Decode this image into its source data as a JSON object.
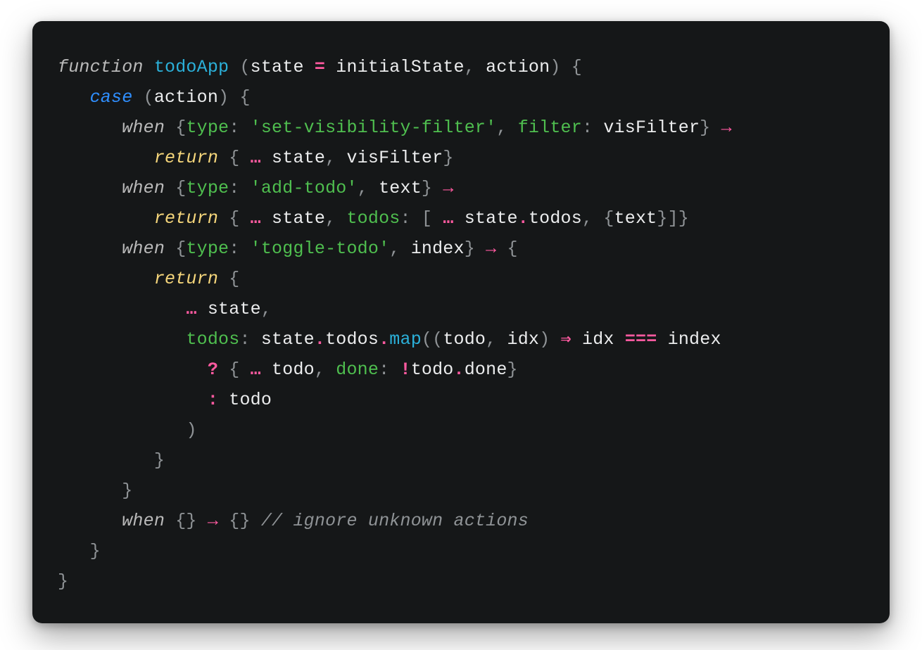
{
  "code": {
    "tokens": [
      [
        [
          "kw",
          "function"
        ],
        [
          "id",
          " "
        ],
        [
          "fn",
          "todoApp"
        ],
        [
          "id",
          " "
        ],
        [
          "punc",
          "("
        ],
        [
          "id",
          "state "
        ],
        [
          "op",
          "="
        ],
        [
          "id",
          " initialState"
        ],
        [
          "punc",
          ","
        ],
        [
          "id",
          " action"
        ],
        [
          "punc",
          ")"
        ],
        [
          "id",
          " "
        ],
        [
          "punc",
          "{"
        ]
      ],
      [
        [
          "id",
          "   "
        ],
        [
          "case",
          "case"
        ],
        [
          "id",
          " "
        ],
        [
          "punc",
          "("
        ],
        [
          "id",
          "action"
        ],
        [
          "punc",
          ")"
        ],
        [
          "id",
          " "
        ],
        [
          "punc",
          "{"
        ]
      ],
      [
        [
          "id",
          "      "
        ],
        [
          "kw",
          "when"
        ],
        [
          "id",
          " "
        ],
        [
          "punc",
          "{"
        ],
        [
          "prop",
          "type"
        ],
        [
          "punc",
          ":"
        ],
        [
          "id",
          " "
        ],
        [
          "str",
          "'set-visibility-filter'"
        ],
        [
          "punc",
          ","
        ],
        [
          "id",
          " "
        ],
        [
          "prop",
          "filter"
        ],
        [
          "punc",
          ":"
        ],
        [
          "id",
          " visFilter"
        ],
        [
          "punc",
          "}"
        ],
        [
          "id",
          " "
        ],
        [
          "op",
          "→"
        ]
      ],
      [
        [
          "id",
          "         "
        ],
        [
          "ret",
          "return"
        ],
        [
          "id",
          " "
        ],
        [
          "punc",
          "{"
        ],
        [
          "id",
          " "
        ],
        [
          "op",
          "…"
        ],
        [
          "id",
          " state"
        ],
        [
          "punc",
          ","
        ],
        [
          "id",
          " visFilter"
        ],
        [
          "punc",
          "}"
        ]
      ],
      [
        [
          "id",
          "      "
        ],
        [
          "kw",
          "when"
        ],
        [
          "id",
          " "
        ],
        [
          "punc",
          "{"
        ],
        [
          "prop",
          "type"
        ],
        [
          "punc",
          ":"
        ],
        [
          "id",
          " "
        ],
        [
          "str",
          "'add-todo'"
        ],
        [
          "punc",
          ","
        ],
        [
          "id",
          " text"
        ],
        [
          "punc",
          "}"
        ],
        [
          "id",
          " "
        ],
        [
          "op",
          "→"
        ]
      ],
      [
        [
          "id",
          "         "
        ],
        [
          "ret",
          "return"
        ],
        [
          "id",
          " "
        ],
        [
          "punc",
          "{"
        ],
        [
          "id",
          " "
        ],
        [
          "op",
          "…"
        ],
        [
          "id",
          " state"
        ],
        [
          "punc",
          ","
        ],
        [
          "id",
          " "
        ],
        [
          "prop",
          "todos"
        ],
        [
          "punc",
          ":"
        ],
        [
          "id",
          " "
        ],
        [
          "punc",
          "["
        ],
        [
          "id",
          " "
        ],
        [
          "op",
          "…"
        ],
        [
          "id",
          " state"
        ],
        [
          "op",
          "."
        ],
        [
          "id",
          "todos"
        ],
        [
          "punc",
          ","
        ],
        [
          "id",
          " "
        ],
        [
          "punc",
          "{"
        ],
        [
          "id",
          "text"
        ],
        [
          "punc",
          "}]}"
        ]
      ],
      [
        [
          "id",
          "      "
        ],
        [
          "kw",
          "when"
        ],
        [
          "id",
          " "
        ],
        [
          "punc",
          "{"
        ],
        [
          "prop",
          "type"
        ],
        [
          "punc",
          ":"
        ],
        [
          "id",
          " "
        ],
        [
          "str",
          "'toggle-todo'"
        ],
        [
          "punc",
          ","
        ],
        [
          "id",
          " index"
        ],
        [
          "punc",
          "}"
        ],
        [
          "id",
          " "
        ],
        [
          "op",
          "→"
        ],
        [
          "id",
          " "
        ],
        [
          "punc",
          "{"
        ]
      ],
      [
        [
          "id",
          "         "
        ],
        [
          "ret",
          "return"
        ],
        [
          "id",
          " "
        ],
        [
          "punc",
          "{"
        ]
      ],
      [
        [
          "id",
          "            "
        ],
        [
          "op",
          "…"
        ],
        [
          "id",
          " state"
        ],
        [
          "punc",
          ","
        ]
      ],
      [
        [
          "id",
          "            "
        ],
        [
          "prop",
          "todos"
        ],
        [
          "punc",
          ":"
        ],
        [
          "id",
          " state"
        ],
        [
          "op",
          "."
        ],
        [
          "id",
          "todos"
        ],
        [
          "op",
          "."
        ],
        [
          "fn",
          "map"
        ],
        [
          "punc",
          "(("
        ],
        [
          "id",
          "todo"
        ],
        [
          "punc",
          ","
        ],
        [
          "id",
          " idx"
        ],
        [
          "punc",
          ")"
        ],
        [
          "id",
          " "
        ],
        [
          "op",
          "⇒"
        ],
        [
          "id",
          " idx "
        ],
        [
          "op",
          "==="
        ],
        [
          "id",
          " index"
        ]
      ],
      [
        [
          "id",
          "              "
        ],
        [
          "op",
          "?"
        ],
        [
          "id",
          " "
        ],
        [
          "punc",
          "{"
        ],
        [
          "id",
          " "
        ],
        [
          "op",
          "…"
        ],
        [
          "id",
          " todo"
        ],
        [
          "punc",
          ","
        ],
        [
          "id",
          " "
        ],
        [
          "prop",
          "done"
        ],
        [
          "punc",
          ":"
        ],
        [
          "id",
          " "
        ],
        [
          "op",
          "!"
        ],
        [
          "id",
          "todo"
        ],
        [
          "op",
          "."
        ],
        [
          "id",
          "done"
        ],
        [
          "punc",
          "}"
        ]
      ],
      [
        [
          "id",
          "              "
        ],
        [
          "op",
          ":"
        ],
        [
          "id",
          " todo"
        ]
      ],
      [
        [
          "id",
          "            "
        ],
        [
          "punc",
          ")"
        ]
      ],
      [
        [
          "id",
          "         "
        ],
        [
          "punc",
          "}"
        ]
      ],
      [
        [
          "id",
          "      "
        ],
        [
          "punc",
          "}"
        ]
      ],
      [
        [
          "id",
          "      "
        ],
        [
          "kw",
          "when"
        ],
        [
          "id",
          " "
        ],
        [
          "punc",
          "{}"
        ],
        [
          "id",
          " "
        ],
        [
          "op",
          "→"
        ],
        [
          "id",
          " "
        ],
        [
          "punc",
          "{}"
        ],
        [
          "id",
          " "
        ],
        [
          "cmnt",
          "// ignore unknown actions"
        ]
      ],
      [
        [
          "id",
          "   "
        ],
        [
          "punc",
          "}"
        ]
      ],
      [
        [
          "punc",
          "}"
        ]
      ]
    ]
  },
  "classmap": {
    "kw": "tok-kw",
    "case": "tok-case",
    "ret": "tok-ret",
    "fn": "tok-fn",
    "prop": "tok-prop",
    "str": "tok-str",
    "op": "tok-op",
    "punc": "tok-punc",
    "id": "tok-id",
    "cmnt": "tok-cmnt"
  }
}
